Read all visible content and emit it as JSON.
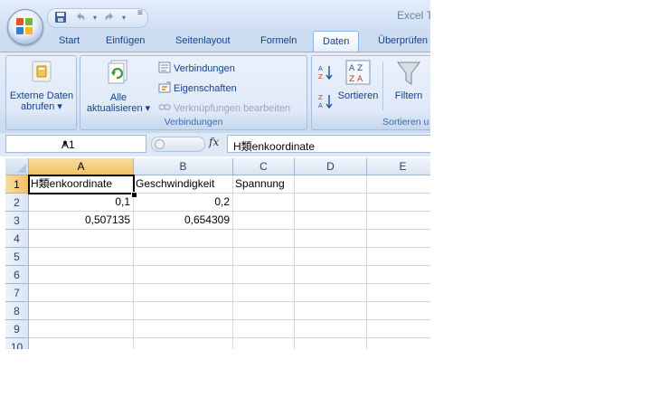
{
  "app": {
    "title": "Excel T",
    "colors": {
      "tab_text": "#15428b",
      "group_label": "#3e6aaa",
      "selected_header": "#f1c15f"
    }
  },
  "quick_access": {
    "icons": [
      "save-icon",
      "undo-icon",
      "redo-icon"
    ],
    "more_label": "≡"
  },
  "tabs": [
    "Start",
    "Einfügen",
    "Seitenlayout",
    "Formeln",
    "Daten",
    "Überprüfen"
  ],
  "active_tab": "Daten",
  "ribbon": {
    "external": {
      "line1": "Externe Daten",
      "line2": "abrufen ▾"
    },
    "connections": {
      "refresh_line1": "Alle",
      "refresh_line2": "aktualisieren ▾",
      "connections_label": "Verbindungen",
      "properties_label": "Eigenschaften",
      "edit_links_label": "Verknüpfungen bearbeiten",
      "group_label": "Verbindungen"
    },
    "sort": {
      "az_label": "A→Z",
      "za_label": "Z→A",
      "sort_label": "Sortieren",
      "filter_label": "Filtern",
      "group_label": "Sortieren u"
    }
  },
  "formula_bar": {
    "name_box": "A1",
    "fx_label": "fx",
    "formula": "H類enkoordinate"
  },
  "sheet": {
    "columns": [
      "A",
      "B",
      "C",
      "D",
      "E"
    ],
    "rows": [
      "1",
      "2",
      "3",
      "4",
      "5",
      "6",
      "7",
      "8",
      "9",
      "10"
    ],
    "cells": {
      "A1": "H類enkoordinate",
      "B1": "Geschwindigkeit",
      "C1": "Spannung",
      "A2": "0,1",
      "B2": "0,2",
      "A3": "0,507135",
      "B3": "0,654309"
    },
    "selected_cell": "A1"
  }
}
